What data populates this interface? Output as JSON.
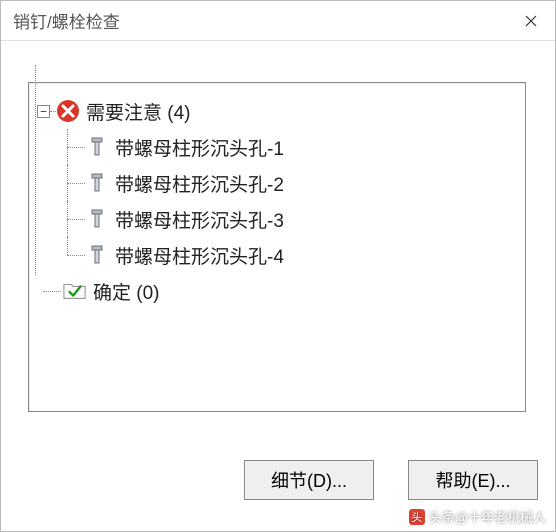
{
  "window": {
    "title": "销钉/螺栓检查"
  },
  "tree": {
    "root": {
      "label": "需要注意 (4)",
      "expanded": true,
      "children": [
        {
          "label": "带螺母柱形沉头孔-1"
        },
        {
          "label": "带螺母柱形沉头孔-2"
        },
        {
          "label": "带螺母柱形沉头孔-3"
        },
        {
          "label": "带螺母柱形沉头孔-4"
        }
      ]
    },
    "ok": {
      "label": "确定 (0)"
    }
  },
  "buttons": {
    "detail": "细节(D)...",
    "help": "帮助(E)..."
  },
  "watermark": "头条@十年老机械人"
}
